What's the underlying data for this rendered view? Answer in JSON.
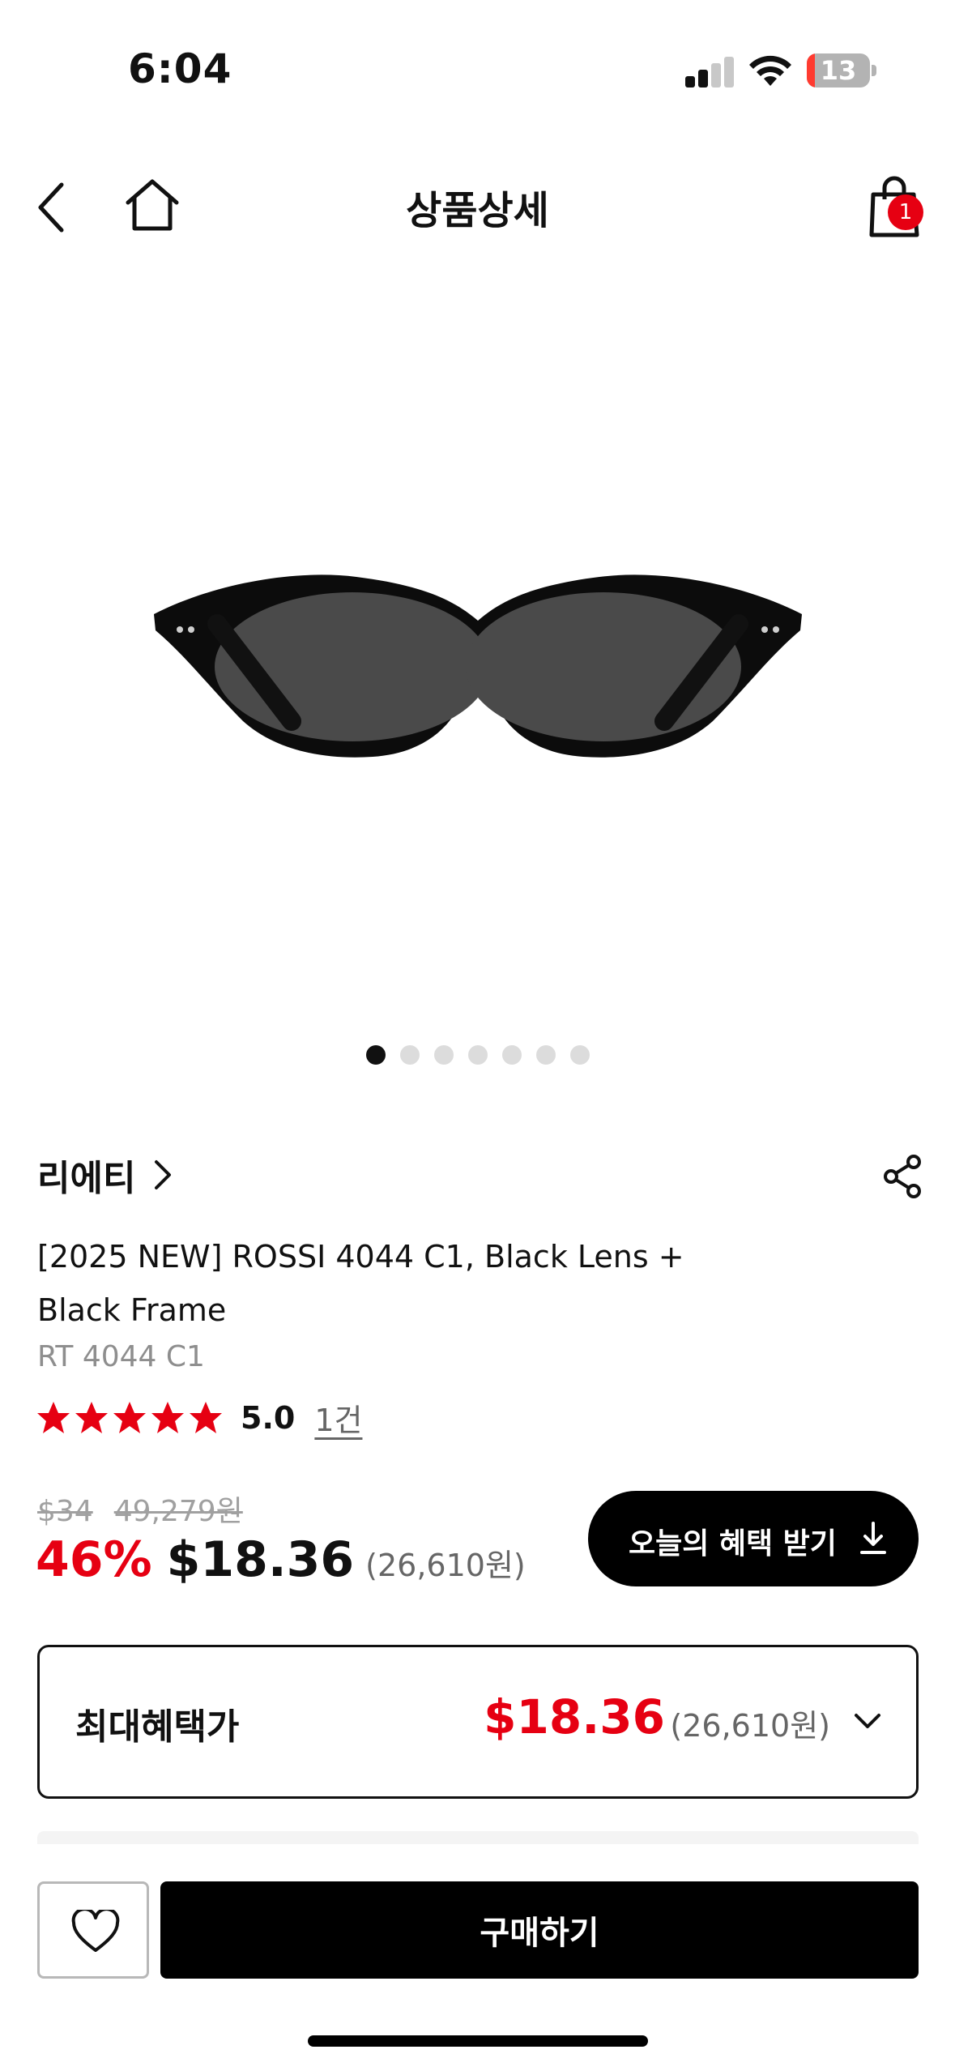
{
  "status_bar": {
    "time": "6:04",
    "battery": "13",
    "battery_level": 0.13,
    "battery_color": "#ff3b30"
  },
  "nav": {
    "title": "상품상세",
    "cart_count": "1",
    "icons": [
      "back-chevron-icon",
      "home-icon",
      "shopping-bag-icon"
    ]
  },
  "gallery": {
    "image_subject": "black oval sunglasses",
    "page_count": 7,
    "active_page": 1
  },
  "product": {
    "brand": "리에티",
    "title": "[2025 NEW] ROSSI 4044 C1, Black Lens + Black Frame",
    "code": "RT 4044 C1",
    "rating": "5.0",
    "stars": 5,
    "review_count": "1건"
  },
  "price": {
    "original_usd": "$34",
    "original_krw": "49,279원",
    "discount": "46%",
    "sale_usd": "$18.36",
    "sale_krw": "(26,610원)",
    "benefit_button": "오늘의 혜택 받기"
  },
  "max_benefit": {
    "label": "최대혜택가",
    "price_usd": "$18.36",
    "price_krw": "(26,610원)"
  },
  "bottom_bar": {
    "buy_label": "구매하기"
  },
  "colors": {
    "accent_red": "#e60012",
    "primary_black": "#000000"
  }
}
